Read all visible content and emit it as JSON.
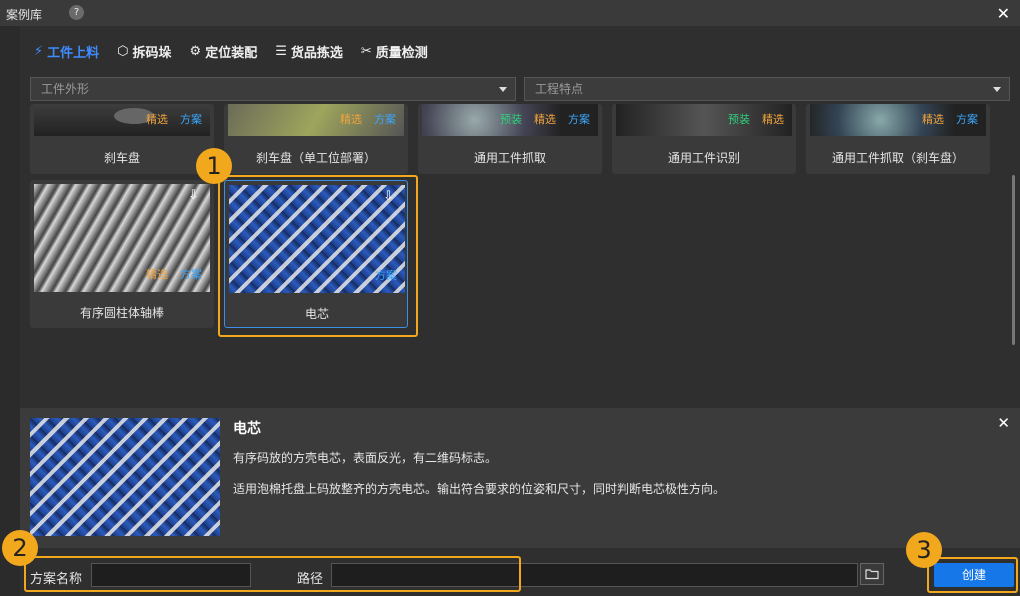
{
  "window": {
    "title": "案例库",
    "help": "?"
  },
  "tabs": [
    {
      "label": "工件上料",
      "icon": "robot-arm-icon",
      "active": true
    },
    {
      "label": "拆码垛",
      "icon": "box-icon"
    },
    {
      "label": "定位装配",
      "icon": "gear-target-icon"
    },
    {
      "label": "货品拣选",
      "icon": "list-icon"
    },
    {
      "label": "质量检测",
      "icon": "tools-icon"
    }
  ],
  "filters": {
    "shape_placeholder": "工件外形",
    "feature_placeholder": "工程特点"
  },
  "cards": [
    {
      "label": "刹车盘",
      "tags": [
        "精选",
        "方案"
      ]
    },
    {
      "label": "刹车盘（单工位部署）",
      "tags": [
        "精选",
        "方案"
      ]
    },
    {
      "label": "通用工件抓取",
      "tags": [
        "预装",
        "精选",
        "方案"
      ]
    },
    {
      "label": "通用工件识别",
      "tags": [
        "预装",
        "精选"
      ]
    },
    {
      "label": "通用工件抓取（刹车盘）",
      "tags": [
        "精选",
        "方案"
      ]
    },
    {
      "label": "有序圆柱体轴棒",
      "tags": [
        "精选",
        "方案"
      ]
    },
    {
      "label": "电芯",
      "tags": [
        "方案"
      ],
      "selected": true
    }
  ],
  "detail": {
    "title": "电芯",
    "desc1": "有序码放的方壳电芯，表面反光，有二维码标志。",
    "desc2": "适用泡棉托盘上码放整齐的方壳电芯。输出符合要求的位姿和尺寸，同时判断电芯极性方向。"
  },
  "form": {
    "name_label": "方案名称",
    "path_label": "路径",
    "create_label": "创建"
  },
  "callouts": [
    "1",
    "2",
    "3"
  ],
  "colors": {
    "accent": "#1677e8",
    "highlight": "#f2a81d",
    "tab_active": "#3f8cff"
  }
}
